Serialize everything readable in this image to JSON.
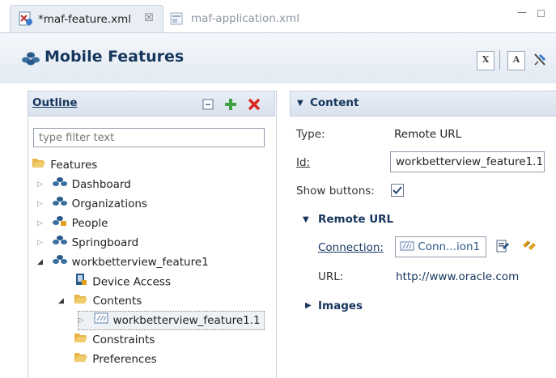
{
  "tabs": [
    {
      "label": "*maf-feature.xml",
      "close": "☒"
    },
    {
      "label": "maf-application.xml"
    }
  ],
  "window": {
    "minimize": "—",
    "maximize": "☐"
  },
  "header": {
    "title": "Mobile Features"
  },
  "outline": {
    "title": "Outline",
    "filter_placeholder": "type filter text",
    "tree": [
      {
        "label": "Features"
      },
      {
        "label": "Dashboard"
      },
      {
        "label": "Organizations"
      },
      {
        "label": "People"
      },
      {
        "label": "Springboard"
      },
      {
        "label": "workbetterview_feature1"
      },
      {
        "label": "Device Access"
      },
      {
        "label": "Contents"
      },
      {
        "label": "workbetterview_feature1.1"
      },
      {
        "label": "Constraints"
      },
      {
        "label": "Preferences"
      }
    ]
  },
  "content": {
    "title": "Content",
    "type_label": "Type:",
    "type_value": "Remote URL",
    "id_label": "Id:",
    "id_value": "workbetterview_feature1.1",
    "show_buttons_label": "Show buttons:",
    "show_buttons_checked": true,
    "remote_url_section": "Remote URL",
    "connection_label": "Connection:",
    "connection_value": "Conn...ion1",
    "url_label": "URL:",
    "url_value": "http://www.oracle.com",
    "images_section": "Images"
  },
  "colors": {
    "accent": "#17365d",
    "panel_header": "#dfe7f1",
    "icon_blue": "#2a5a8a"
  }
}
